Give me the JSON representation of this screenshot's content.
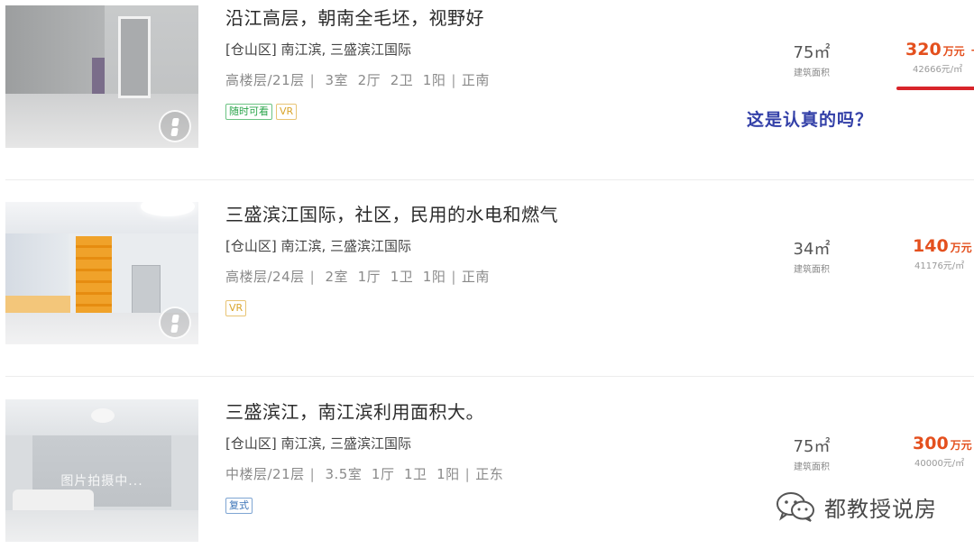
{
  "listings": [
    {
      "title": "沿江高层，朝南全毛坯，视野好",
      "community": "[仓山区] 南江滨, 三盛滨江国际",
      "attrs": [
        "高楼层/21层",
        "3室",
        "2厅",
        "2卫",
        "1阳",
        "正南"
      ],
      "tags": [
        {
          "text": "随时可看",
          "style": "green"
        },
        {
          "text": "VR",
          "style": "gold"
        }
      ],
      "area": "75㎡",
      "area_label": "建筑面积",
      "price_total": "320",
      "price_unit": "万元",
      "price_trail": "-",
      "price_per": "42666元/㎡",
      "has_vr_badge": true,
      "thumb_icon": "vr-cube-icon"
    },
    {
      "title": "三盛滨江国际，社区，民用的水电和燃气",
      "community": "[仓山区] 南江滨, 三盛滨江国际",
      "attrs": [
        "高楼层/24层",
        "2室",
        "1厅",
        "1卫",
        "1阳",
        "正南"
      ],
      "tags": [
        {
          "text": "VR",
          "style": "gold"
        }
      ],
      "area": "34㎡",
      "area_label": "建筑面积",
      "price_total": "140",
      "price_unit": "万元",
      "price_per": "41176元/㎡",
      "has_vr_badge": true,
      "thumb_icon": "vr-cube-icon"
    },
    {
      "title": "三盛滨江，南江滨利用面积大。",
      "community": "[仓山区] 南江滨, 三盛滨江国际",
      "attrs": [
        "中楼层/21层",
        "3.5室",
        "1厅",
        "1卫",
        "1阳",
        "正东"
      ],
      "tags": [
        {
          "text": "复式",
          "style": "blue"
        }
      ],
      "area": "75㎡",
      "area_label": "建筑面积",
      "price_total": "300",
      "price_unit": "万元",
      "price_per": "40000元/㎡",
      "has_vr_badge": false,
      "thumb_caption": "图片拍摄中..."
    }
  ],
  "annotation": {
    "text": "这是认真的吗？",
    "color": "#3340a8",
    "underline_color": "#d8242a"
  },
  "watermark": {
    "text": "都教授说房",
    "icon": "wechat-icon"
  },
  "colors": {
    "price": "#e4501e",
    "tag_green": "#2aa44a",
    "tag_gold": "#d9a42b",
    "tag_blue": "#3a73b7"
  }
}
